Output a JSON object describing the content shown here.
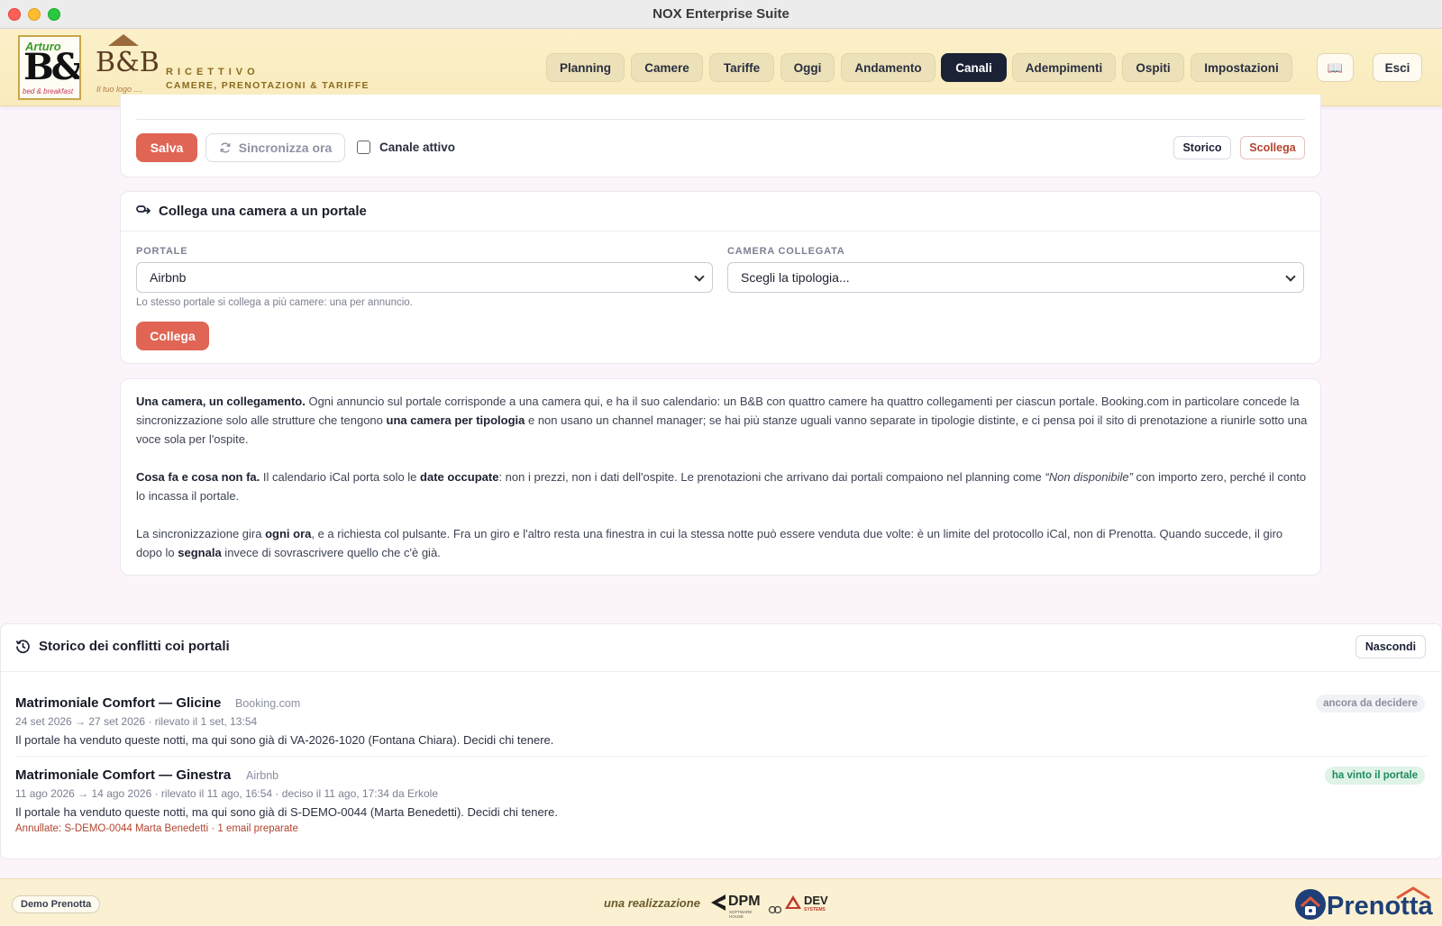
{
  "window": {
    "title": "NOX Enterprise Suite"
  },
  "brand": {
    "logo1_main": "B&B",
    "logo1_top": "Arturo",
    "logo1_sub": "bed & breakfast",
    "logo2_main": "B&B",
    "logo2_tag": "Il tuo logo ....",
    "line1": "RICETTIVO",
    "line2": "CAMERE, PRENOTAZIONI & TARIFFE"
  },
  "nav": {
    "items": [
      "Planning",
      "Camere",
      "Tariffe",
      "Oggi",
      "Andamento",
      "Canali",
      "Adempimenti",
      "Ospiti",
      "Impostazioni"
    ],
    "active": "Canali",
    "book_icon": "📖",
    "logout": "Esci"
  },
  "sync_card": {
    "save": "Salva",
    "sync": "Sincronizza ora",
    "active_label": "Canale attivo",
    "active_checked": false,
    "history": "Storico",
    "unlink": "Scollega"
  },
  "link_card": {
    "title": "Collega una camera a un portale",
    "portal_label": "PORTALE",
    "portal_value": "Airbnb",
    "room_label": "CAMERA COLLEGATA",
    "room_value": "Scegli la tipologia...",
    "hint": "Lo stesso portale si collega a più camere: una per annuncio.",
    "link_button": "Collega"
  },
  "info": {
    "p1_b1": "Una camera, un collegamento.",
    "p1_t1": " Ogni annuncio sul portale corrisponde a una camera qui, e ha il suo calendario: un B&B con quattro camere ha quattro collegamenti per ciascun portale. Booking.com in particolare concede la sincronizzazione solo alle strutture che tengono ",
    "p1_b2": "una camera per tipologia",
    "p1_t2": " e non usano un channel manager; se hai più stanze uguali vanno separate in tipologie distinte, e ci pensa poi il sito di prenotazione a riunirle sotto una voce sola per l'ospite.",
    "p2_b1": "Cosa fa e cosa non fa.",
    "p2_t1": " Il calendario iCal porta solo le ",
    "p2_b2": "date occupate",
    "p2_t2": ": non i prezzi, non i dati dell'ospite. Le prenotazioni che arrivano dai portali compaiono nel planning come ",
    "p2_i1": "“Non disponibile”",
    "p2_t3": " con importo zero, perché il conto lo incassa il portale.",
    "p3_t1": "La sincronizzazione gira ",
    "p3_b1": "ogni ora",
    "p3_t2": ", e a richiesta col pulsante. Fra un giro e l'altro resta una finestra in cui la stessa notte può essere venduta due volte: è un limite del protocollo iCal, non di Prenotta. Quando succede, il giro dopo lo ",
    "p3_b2": "segnala",
    "p3_t3": " invece di sovrascrivere quello che c'è già."
  },
  "conflicts": {
    "title": "Storico dei conflitti coi portali",
    "hide": "Nascondi",
    "items": [
      {
        "room": "Matrimoniale Comfort — Glicine",
        "portal": "Booking.com",
        "meta": "24 set 2026 → 27 set 2026 · rilevato il 1 set, 13:54",
        "text": "Il portale ha venduto queste notti, ma qui sono già di VA-2026-1020 (Fontana Chiara). Decidi chi tenere.",
        "status": "ancora da decidere",
        "extra": ""
      },
      {
        "room": "Matrimoniale Comfort — Ginestra",
        "portal": "Airbnb",
        "meta": "11 ago 2026 → 14 ago 2026 · rilevato il 11 ago, 16:54 · deciso il 11 ago, 17:34 da Erkole",
        "text": "Il portale ha venduto queste notti, ma qui sono già di S-DEMO-0044 (Marta Benedetti). Decidi chi tenere.",
        "status": "ha vinto il portale",
        "extra": "Annullate: S-DEMO-0044 Marta Benedetti · 1 email preparate"
      }
    ]
  },
  "footer": {
    "demo": "Demo Prenotta",
    "made_by": "una realizzazione",
    "dpm": "DPM",
    "dpm_sub": "SOFTWARE HOUSE",
    "dev": "DEV",
    "dev_sub": "SYSTEMS",
    "prenotta": "Prenotta"
  },
  "colors": {
    "accent_red": "#e06554",
    "nav_active": "#1c2235",
    "header_bg": "#fbf0c8",
    "status_green": "#1f8a5b"
  }
}
